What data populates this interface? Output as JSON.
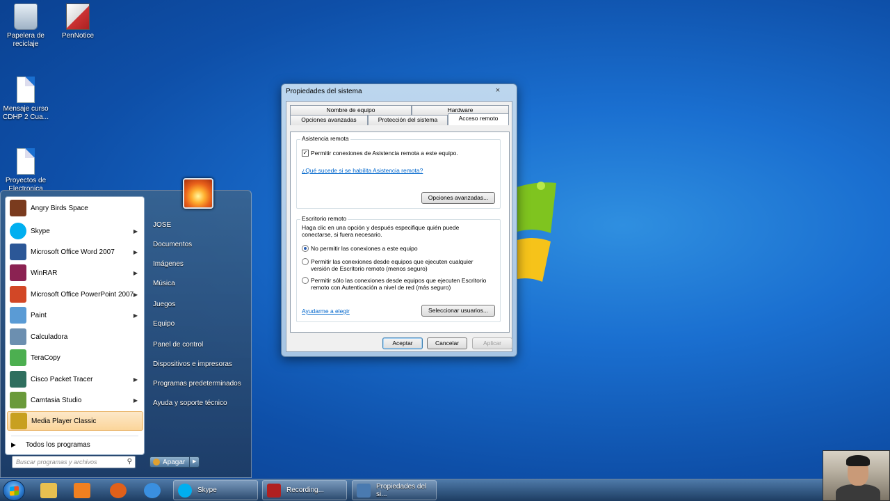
{
  "desktop": {
    "icons": [
      {
        "label": "Papelera de reciclaje",
        "icon": "recycle-bin-icon"
      },
      {
        "label": "PenNotice",
        "icon": "pennotice-icon"
      },
      {
        "label": "Mensaje curso CDHP 2 Cua...",
        "icon": "document-icon"
      },
      {
        "label": "Proyectos de Electronica",
        "icon": "document-icon"
      }
    ]
  },
  "start_menu": {
    "programs": [
      {
        "label": "Angry Birds Space",
        "submenu": false,
        "color": "#7a3b1e"
      },
      {
        "label": "Skype",
        "submenu": true,
        "color": "#00aff0"
      },
      {
        "label": "Microsoft Office Word 2007",
        "submenu": true,
        "color": "#2b5797"
      },
      {
        "label": "WinRAR",
        "submenu": true,
        "color": "#8b2252"
      },
      {
        "label": "Microsoft Office PowerPoint 2007",
        "submenu": true,
        "color": "#d24726"
      },
      {
        "label": "Paint",
        "submenu": true,
        "color": "#5a9bd5"
      },
      {
        "label": "Calculadora",
        "submenu": false,
        "color": "#6c8fb0"
      },
      {
        "label": "TeraCopy",
        "submenu": false,
        "color": "#4caf50"
      },
      {
        "label": "Cisco Packet Tracer",
        "submenu": true,
        "color": "#2f6f5f"
      },
      {
        "label": "Camtasia Studio",
        "submenu": true,
        "color": "#6a9a3a"
      },
      {
        "label": "Media Player Classic",
        "submenu": false,
        "color": "#c8a020",
        "highlighted": true
      }
    ],
    "all_programs": "Todos los programas",
    "search_placeholder": "Buscar programas y archivos",
    "right_items": [
      "JOSE",
      "Documentos",
      "Imágenes",
      "Música",
      "Juegos",
      "Equipo",
      "Panel de control",
      "Dispositivos e impresoras",
      "Programas predeterminados",
      "Ayuda y soporte técnico"
    ],
    "shutdown_label": "Apagar"
  },
  "dialog": {
    "title": "Propiedades del sistema",
    "close": "×",
    "tabs_row1": [
      "Nombre de equipo",
      "Hardware"
    ],
    "tabs_row2": [
      "Opciones avanzadas",
      "Protección del sistema",
      "Acceso remoto"
    ],
    "active_tab": "Acceso remoto",
    "remote_assistance": {
      "group_label": "Asistencia remota",
      "checkbox_label": "Permitir conexiones de Asistencia remota a este equipo.",
      "checked": true,
      "link": "¿Qué sucede si se habilita Asistencia remota?",
      "advanced_button": "Opciones avanzadas..."
    },
    "remote_desktop": {
      "group_label": "Escritorio remoto",
      "description": "Haga clic en una opción y después especifique quién puede conectarse, si fuera necesario.",
      "options": [
        {
          "label": "No permitir las conexiones a este equipo",
          "selected": true
        },
        {
          "label": "Permitir las conexiones desde equipos que ejecuten cualquier versión de Escritorio remoto (menos seguro)",
          "selected": false
        },
        {
          "label": "Permitir sólo las conexiones desde equipos que ejecuten Escritorio remoto con Autenticación a nivel de red (más seguro)",
          "selected": false
        }
      ],
      "help_link": "Ayudarme a elegir",
      "select_users_button": "Seleccionar usuarios..."
    },
    "buttons": {
      "ok": "Aceptar",
      "cancel": "Cancelar",
      "apply": "Aplicar"
    }
  },
  "taskbar": {
    "pinned": [
      {
        "icon": "explorer-icon",
        "color": "#e8c050"
      },
      {
        "icon": "media-player-icon",
        "color": "#f08020"
      },
      {
        "icon": "firefox-icon",
        "color": "#e0601a"
      },
      {
        "icon": "internet-explorer-icon",
        "color": "#3a8fe0"
      }
    ],
    "tasks": [
      {
        "label": "Skype",
        "color": "#00aff0"
      },
      {
        "label": "Recording...",
        "color": "#b02020"
      },
      {
        "label": "Propiedades del si...",
        "color": "#4a7ab0"
      }
    ]
  },
  "colors": {
    "accent": "#1a6fd0",
    "link": "#0066cc"
  }
}
